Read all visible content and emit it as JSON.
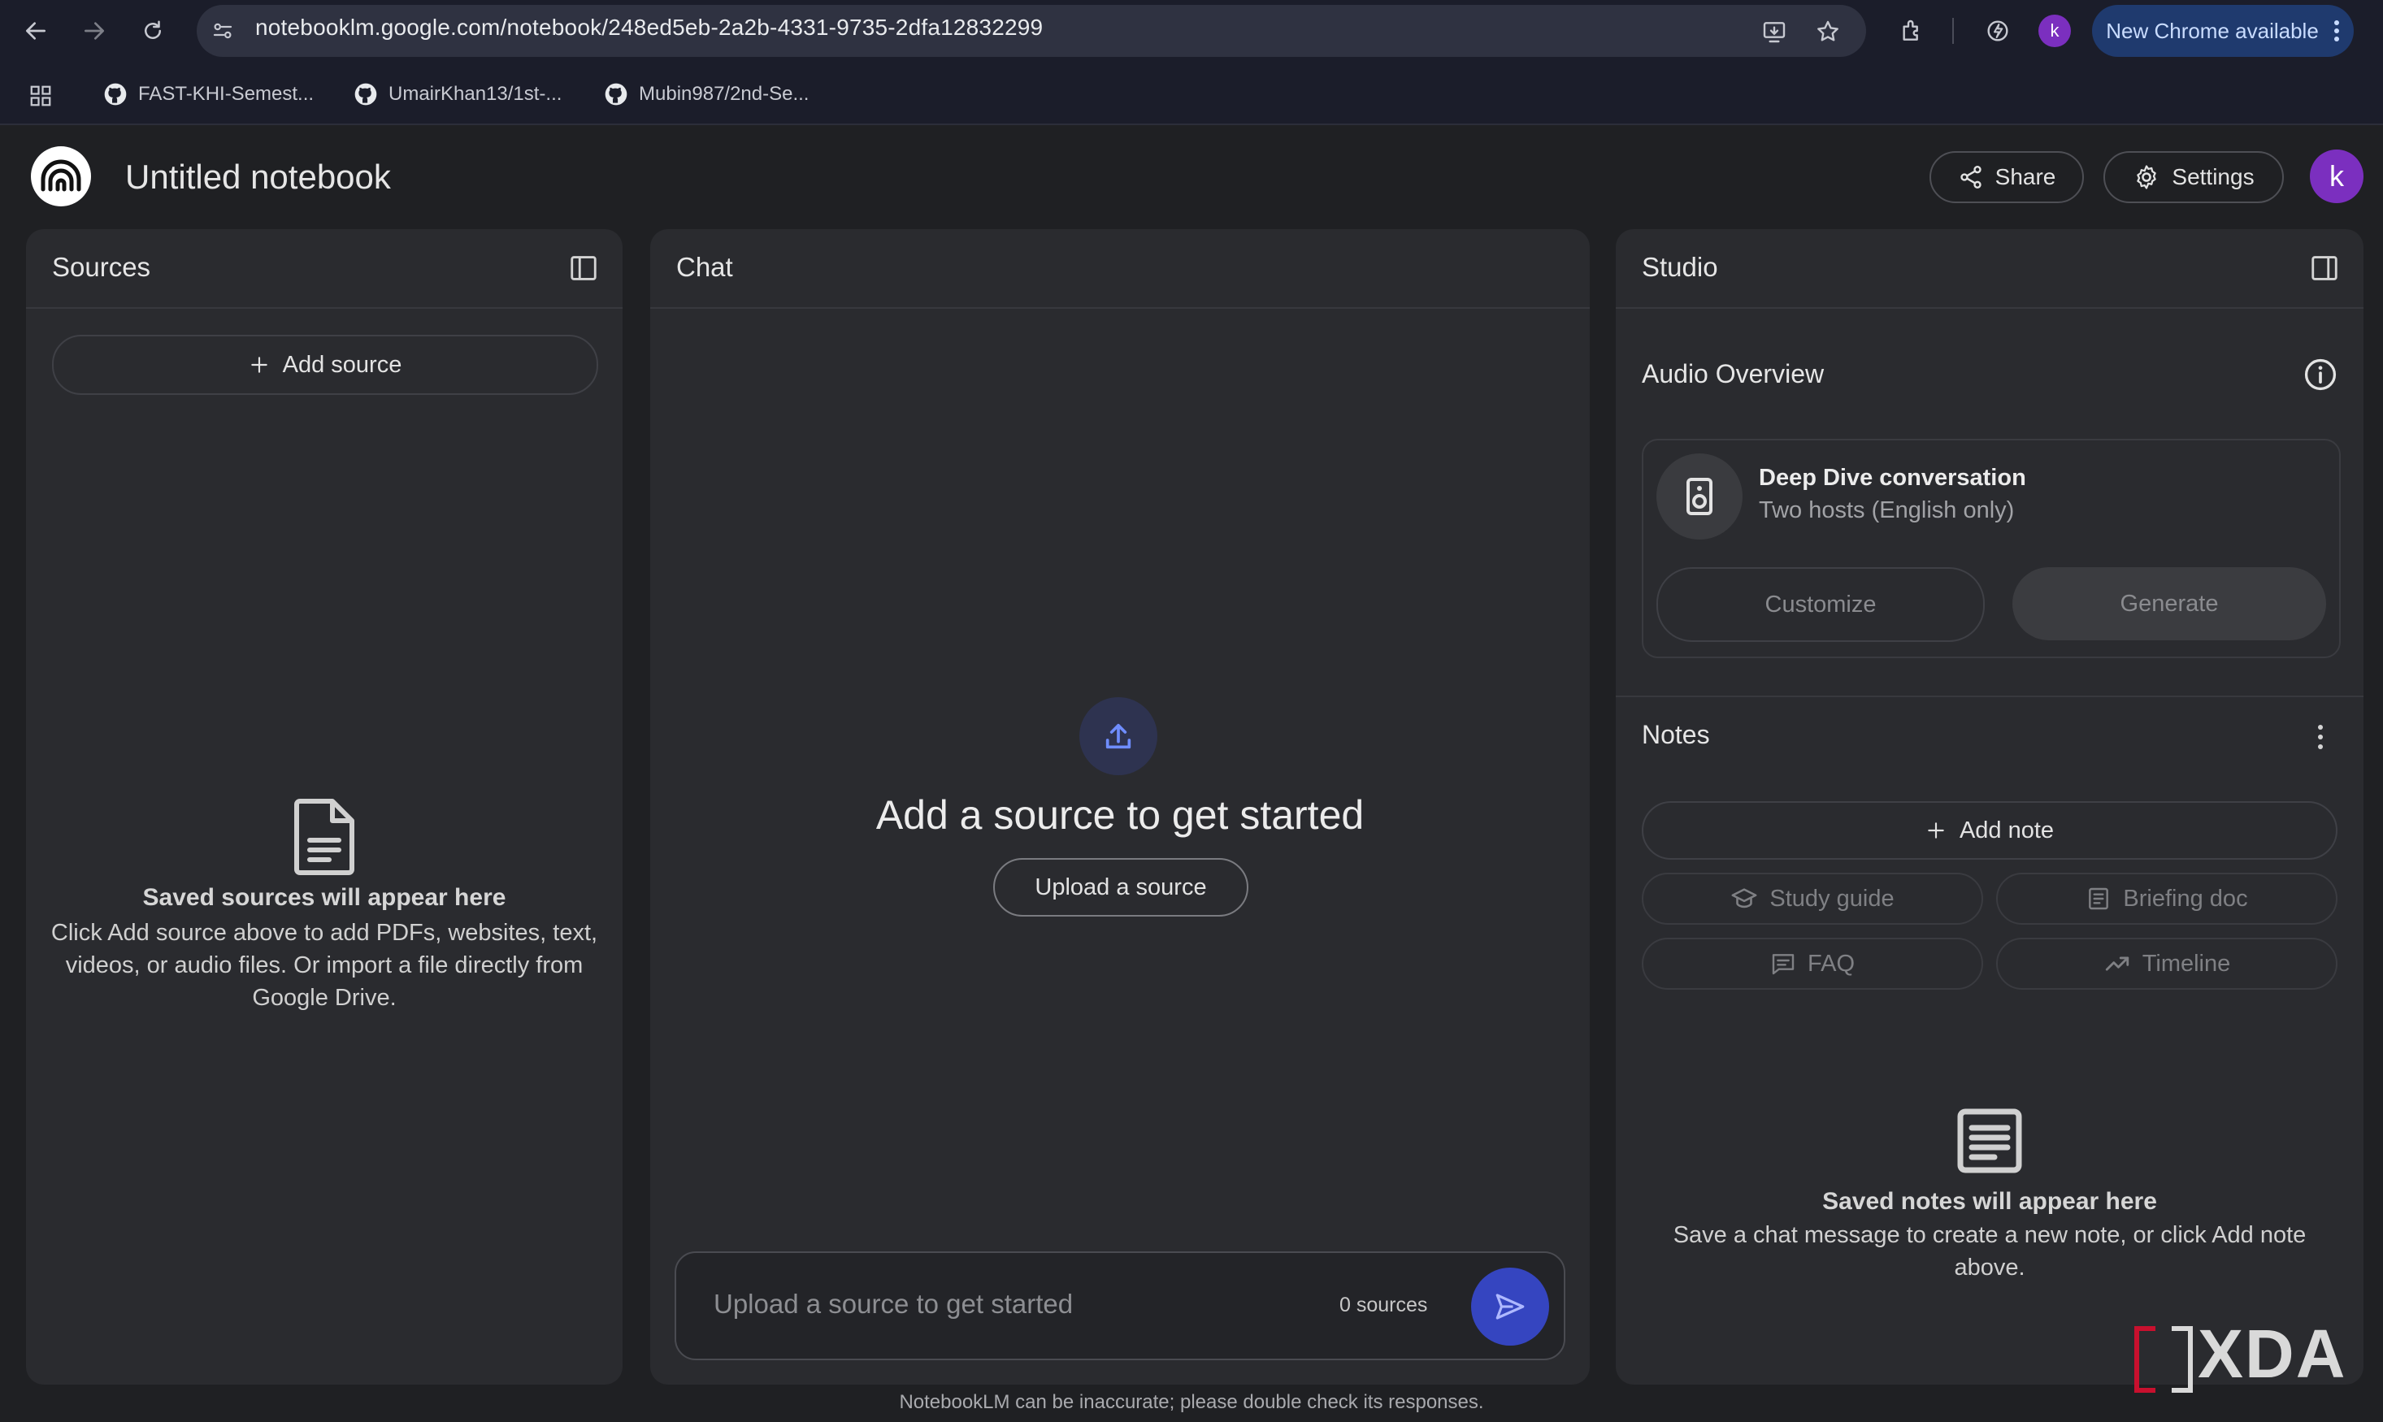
{
  "browser": {
    "url": "notebooklm.google.com/notebook/248ed5eb-2a2b-4331-9735-2dfa12832299",
    "new_chrome_label": "New Chrome available",
    "profile_initial": "k",
    "bookmarks": [
      {
        "label": "FAST-KHI-Semest..."
      },
      {
        "label": "UmairKhan13/1st-..."
      },
      {
        "label": "Mubin987/2nd-Se..."
      }
    ]
  },
  "header": {
    "title": "Untitled notebook",
    "share_label": "Share",
    "settings_label": "Settings",
    "avatar_initial": "k"
  },
  "sources": {
    "title": "Sources",
    "add_source_label": "Add source",
    "empty_title": "Saved sources will appear here",
    "empty_body": "Click Add source above to add PDFs, websites, text, videos, or audio files. Or import a file directly from Google Drive."
  },
  "chat": {
    "title": "Chat",
    "empty_title": "Add a source to get started",
    "upload_label": "Upload a source",
    "input_placeholder": "Upload a source to get started",
    "sources_count": "0 sources"
  },
  "studio": {
    "title": "Studio",
    "audio_overview_title": "Audio Overview",
    "deep_dive_title": "Deep Dive conversation",
    "deep_dive_subtitle": "Two hosts (English only)",
    "customize_label": "Customize",
    "generate_label": "Generate",
    "notes_title": "Notes",
    "add_note_label": "Add note",
    "chips": {
      "study_guide": "Study guide",
      "briefing_doc": "Briefing doc",
      "faq": "FAQ",
      "timeline": "Timeline"
    },
    "empty_title": "Saved notes will appear here",
    "empty_body": "Save a chat message to create a new note, or click Add note above."
  },
  "footer": {
    "note": "NotebookLM can be inaccurate; please double check its responses."
  },
  "watermark": {
    "text": "XDA"
  },
  "colors": {
    "background": "#1f2023",
    "panel": "#2a2b2f",
    "accent_send": "#3545c0",
    "avatar": "#7b2fbf",
    "new_chrome_bg": "#1f3a6e"
  }
}
